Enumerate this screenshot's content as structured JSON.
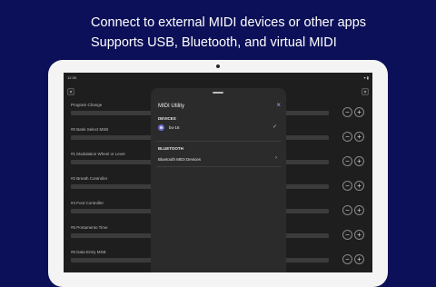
{
  "promo": {
    "line1": "Connect to external MIDI devices or other apps",
    "line2": "Supports USB, Bluetooth, and virtual MIDI"
  },
  "status": {
    "time": "12:30",
    "icons": "▾ ▮"
  },
  "controls": [
    {
      "label": "Program Change",
      "value": 0
    },
    {
      "label": "#0 Bank Select MSB",
      "value": 0
    },
    {
      "label": "#1 Modulation Wheel or Lever",
      "value": 0
    },
    {
      "label": "#2 Breath Controller",
      "value": 0
    },
    {
      "label": "#4 Foot Controller",
      "value": 0
    },
    {
      "label": "#5 Portamento Time",
      "value": 0
    },
    {
      "label": "#6 Data Entry MSB",
      "value": 0
    }
  ],
  "buttons": {
    "minus": "−",
    "plus": "+"
  },
  "modal": {
    "title": "MIDI Utility",
    "close": "×",
    "devices_header": "DEVICES",
    "device_name": "bo-16",
    "device_check": "✓",
    "bluetooth_header": "BLUETOOTH",
    "bluetooth_item": "Bluetooth MIDI Devices",
    "bluetooth_chevron": "›"
  },
  "colors": {
    "background": "#0c1059",
    "accent": "#9aa7ff"
  }
}
